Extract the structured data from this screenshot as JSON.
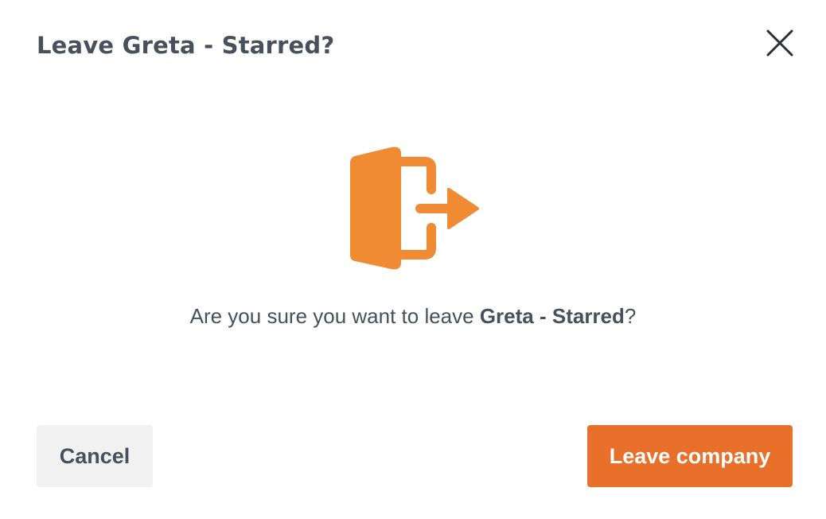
{
  "dialog": {
    "title": "Leave Greta - Starred?",
    "message_prefix": "Are you sure you want to leave ",
    "company_name": "Greta - Starred",
    "message_suffix": "?",
    "illustration_icon": "door-exit-icon",
    "close_icon": "close-icon"
  },
  "actions": {
    "cancel_label": "Cancel",
    "confirm_label": "Leave company"
  },
  "colors": {
    "accent": "#e8702a",
    "illustration": "#f08a33",
    "text": "#4a4f5c",
    "cancel_bg": "#f1f1f1",
    "close": "#2b2f3a"
  }
}
